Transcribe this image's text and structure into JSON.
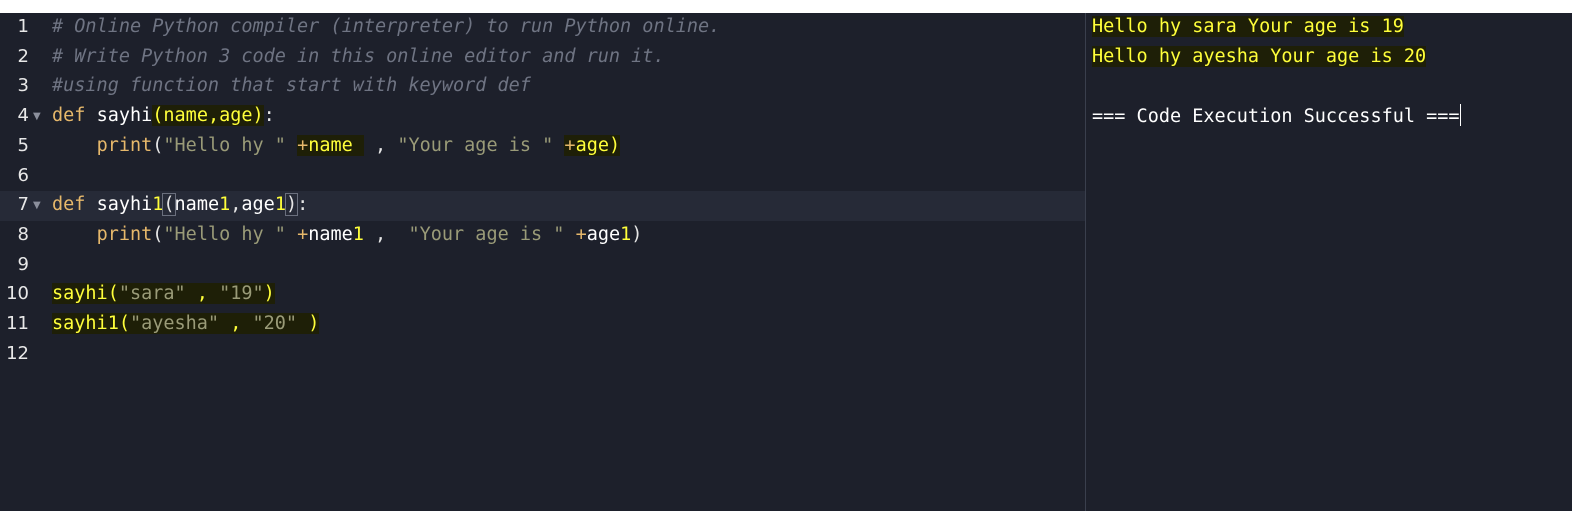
{
  "editor": {
    "lines": [
      {
        "num": "1",
        "comment": "# Online Python compiler (interpreter) to run Python online."
      },
      {
        "num": "2",
        "comment": "# Write Python 3 code in this online editor and run it."
      },
      {
        "num": "3",
        "comment": "#using function that start with keyword def"
      },
      {
        "num": "4",
        "kw": "def",
        "fn": "sayhi",
        "open": "(",
        "params": "name,age",
        "close": ")",
        "colon": ":"
      },
      {
        "num": "5",
        "indent": "    ",
        "bi": "print",
        "open": "(",
        "s1": "\"Hello hy \"",
        "sp1": " ",
        "plus1": "+",
        "v1": "name",
        "sep": " , ",
        "s2": "\"Your age is \"",
        "sp2": " ",
        "plus2": "+",
        "v2": "age",
        "close": ")"
      },
      {
        "num": "6"
      },
      {
        "num": "7",
        "kw": "def",
        "fn": "sayhi",
        "fnsuffix": "1",
        "open": "(",
        "p1": "name",
        "p1s": "1",
        "comma": ",",
        "p2": "age",
        "p2s": "1",
        "close": ")",
        "colon": ":"
      },
      {
        "num": "8",
        "indent": "    ",
        "bi": "print",
        "open": "(",
        "s1": "\"Hello hy \"",
        "sp1": " ",
        "plus1": "+",
        "v1": "name",
        "v1s": "1",
        "sep": " ,  ",
        "s2": "\"Your age is \"",
        "sp2": " ",
        "plus2": "+",
        "v2": "age",
        "v2s": "1",
        "close": ")"
      },
      {
        "num": "9"
      },
      {
        "num": "10",
        "fn": "sayhi",
        "open": "(",
        "a1": "\"sara\"",
        "sep": " , ",
        "a2": "\"19\"",
        "close": ")"
      },
      {
        "num": "11",
        "fn": "sayhi1",
        "open": "(",
        "a1": "\"ayesha\"",
        "sep": " , ",
        "a2": "\"20\"",
        "sp": " ",
        "close": ")"
      },
      {
        "num": "12"
      }
    ]
  },
  "output": {
    "lines": [
      "Hello hy sara Your age is 19",
      "Hello hy ayesha Your age is 20",
      "",
      "=== Code Execution Successful ==="
    ]
  },
  "colors": {
    "background": "#1d202b",
    "highlight_text": "#ffff3a",
    "keyword": "#e6b86b",
    "string": "#9a9b78",
    "comment": "#6f7483"
  }
}
